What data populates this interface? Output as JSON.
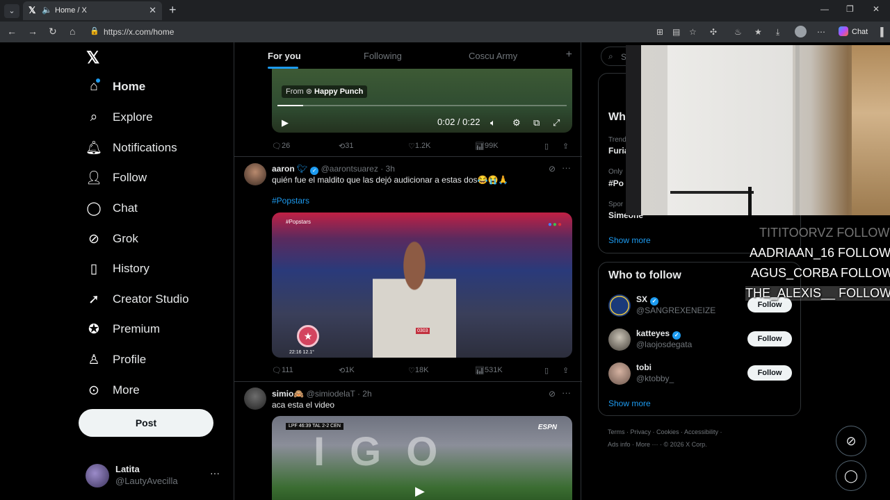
{
  "browser": {
    "tab_title": "Home / X",
    "url": "https://x.com/home",
    "chat_label": "Chat"
  },
  "nav": {
    "items": [
      {
        "label": "Home",
        "icon": "home-icon"
      },
      {
        "label": "Explore",
        "icon": "search-icon"
      },
      {
        "label": "Notifications",
        "icon": "bell-icon"
      },
      {
        "label": "Follow",
        "icon": "person-plus-icon"
      },
      {
        "label": "Chat",
        "icon": "chat-bubble-icon"
      },
      {
        "label": "Grok",
        "icon": "grok-icon"
      },
      {
        "label": "History",
        "icon": "bookmark-icon"
      },
      {
        "label": "Creator Studio",
        "icon": "rocket-icon"
      },
      {
        "label": "Premium",
        "icon": "verified-badge-icon"
      },
      {
        "label": "Profile",
        "icon": "person-icon"
      },
      {
        "label": "More",
        "icon": "more-circle-icon"
      }
    ],
    "post_label": "Post",
    "account": {
      "name": "Latita",
      "handle": "@LautyAvecilla"
    }
  },
  "feed": {
    "tabs": [
      "For you",
      "Following",
      "Coscu Army"
    ],
    "video1": {
      "from_prefix": "From",
      "from_name": "Happy Punch",
      "time": "0:02 / 0:22",
      "progress_fraction": 0.09,
      "stats": {
        "replies": "26",
        "reposts": "31",
        "likes": "1.2K",
        "views": "99K"
      }
    },
    "tweet2": {
      "name": "aaron",
      "handle": "@aarontsuarez",
      "time": "· 3h",
      "text": "quién fue el maldito que las dejó audicionar a estas dos😂😭🙏",
      "hashtag": "#Popstars",
      "image_tag": "#Popstars",
      "image_time": "22:16   12.1°",
      "image_number": "0303",
      "stats": {
        "replies": "111",
        "reposts": "1K",
        "likes": "18K",
        "views": "531K"
      }
    },
    "tweet3": {
      "name": "simio🙈",
      "handle": "@simiodelaT",
      "time": "· 2h",
      "text": "aca esta el video",
      "score": "LPF 46:39  TAL 2-2 CEN",
      "network": "ESPN"
    }
  },
  "sidebar": {
    "search_placeholder": "Se",
    "trends_title": "Wh",
    "trends": [
      {
        "meta": "Trend",
        "name": "Furia"
      },
      {
        "meta": "Only",
        "name": "#Po"
      },
      {
        "meta": "Spor",
        "name": "Simeone"
      }
    ],
    "trends_show_more": "Show more",
    "who_to_follow_title": "Who to follow",
    "suggestions": [
      {
        "name": "SX",
        "handle": "@SANGREXENEIZE",
        "verified": true,
        "button": "Follow"
      },
      {
        "name": "katteyes",
        "handle": "@laojosdegata",
        "verified": true,
        "button": "Follow"
      },
      {
        "name": "tobi",
        "handle": "@ktobby_",
        "verified": false,
        "button": "Follow"
      }
    ],
    "wtf_show_more": "Show more",
    "footer_line1": "Terms  ·  Privacy  ·  Cookies  ·  Accessibility  ·",
    "footer_line2": "Ads info  ·  More ···  ·  © 2026 X Corp."
  },
  "stream_overlay": {
    "lines": [
      {
        "text": "TITITOORVZ  FOLLOW",
        "style": "dim"
      },
      {
        "text": "AADRIAAN_16  FOLLOW",
        "style": "normal"
      },
      {
        "text": "AGUS_CORBA  FOLLOW",
        "style": "normal"
      },
      {
        "text": "THE_ALEXIS__  FOLLOW",
        "style": "highlight"
      }
    ]
  }
}
